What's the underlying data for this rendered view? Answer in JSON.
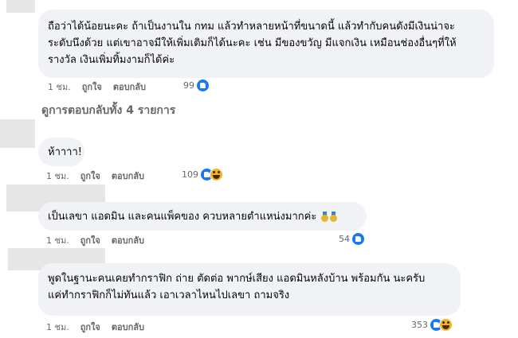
{
  "comments": [
    {
      "lines": [
        "ถือว่าได้น้อยนะคะ ถ้าเป็นงานใน กทม แล้วทำหลายหน้าที่ขนาดนี้ แล้วทำกับคนดังมีเงินน่าจะ",
        "ระดับนึงด้วย แต่เขาอาจมีให้เพิ่มเติมก็ได้นะคะ เช่น มีของขวัญ มีแจกเงิน เหมือนช่องอื่นๆที่ให้",
        "รางวัล เงินเพิ่มทิ้มงามก็ได้ค่ะ"
      ],
      "time": "1 ชม.",
      "like": "ถูกใจ",
      "reply": "ตอบกลับ",
      "reactions": "99"
    },
    {
      "lines": [
        "ห้าาาา!"
      ],
      "time": "1 ชม.",
      "like": "ถูกใจ",
      "reply": "ตอบกลับ",
      "reactions": "109"
    },
    {
      "lines": [
        "เป็นเลขา แอดมิน และคนแพ็คของ ควบหลายตำแหน่งมากค่ะ"
      ],
      "time": "1 ชม.",
      "like": "ถูกใจ",
      "reply": "ตอบกลับ",
      "reactions": "54"
    },
    {
      "lines": [
        "พูดในฐานะคนเคยทำกราฟิก ถ่าย ตัดต่อ พากษ์เสียง แอดมินหลังบ้าน พร้อมกัน นะครับ",
        "แค่ทำกราฟิกก็ไม่ทันแล้ว เอาเวลาไหนไปเลขา ถามจริง"
      ],
      "time": "1 ชม.",
      "like": "ถูกใจ",
      "reply": "ตอบกลับ",
      "reactions": "353"
    }
  ],
  "view_replies": "ดูการตอบกลับทั้ง 4 รายการ",
  "icons": {
    "like": "like-reaction-icon",
    "haha": "haha-reaction-icon",
    "medal": "medal-emoji-icon"
  },
  "colors": {
    "bubble": "#f0f2f5",
    "meta": "#65676b",
    "like": "#1877f2",
    "haha": "#f7b125"
  }
}
